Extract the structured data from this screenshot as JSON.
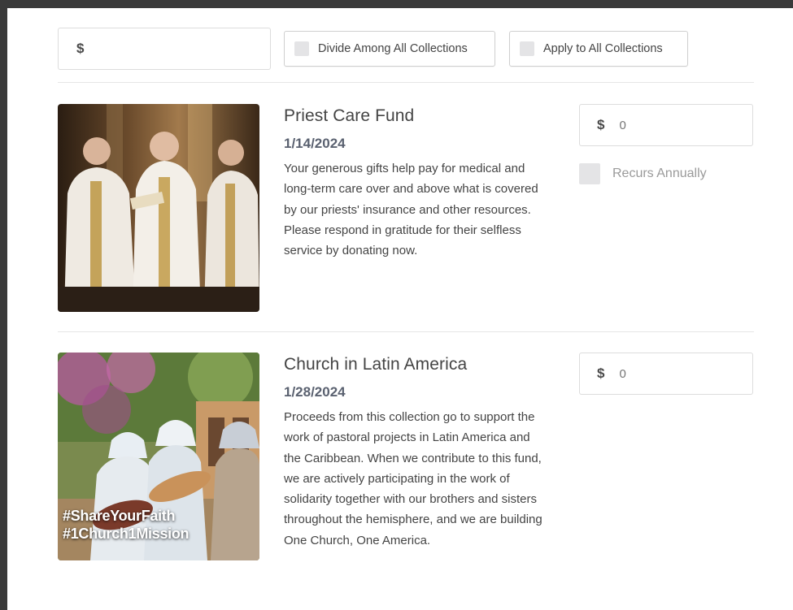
{
  "top_bar": {
    "amount_currency": "$",
    "divide_label": "Divide Among All Collections",
    "apply_label": "Apply to All Collections"
  },
  "funds": [
    {
      "title": "Priest Care Fund",
      "date": "1/14/2024",
      "description": "Your generous gifts help pay for medical and long-term care over and above what is covered by our priests' insurance and other resources. Please respond in gratitude for their selfless service by donating now.",
      "currency": "$",
      "amount_placeholder": "0",
      "recurs_label": "Recurs Annually"
    },
    {
      "title": "Church in Latin America",
      "date": "1/28/2024",
      "description": "Proceeds from this collection go to support the work of pastoral projects in Latin America and the Caribbean. When we contribute to this fund, we are actively participating in the work of solidarity together with our brothers and sisters throughout the hemisphere, and we are building One Church, One America.",
      "currency": "$",
      "amount_placeholder": "0",
      "image_hashtags": [
        "#ShareYourFaith",
        "#1Church1Mission"
      ]
    }
  ]
}
